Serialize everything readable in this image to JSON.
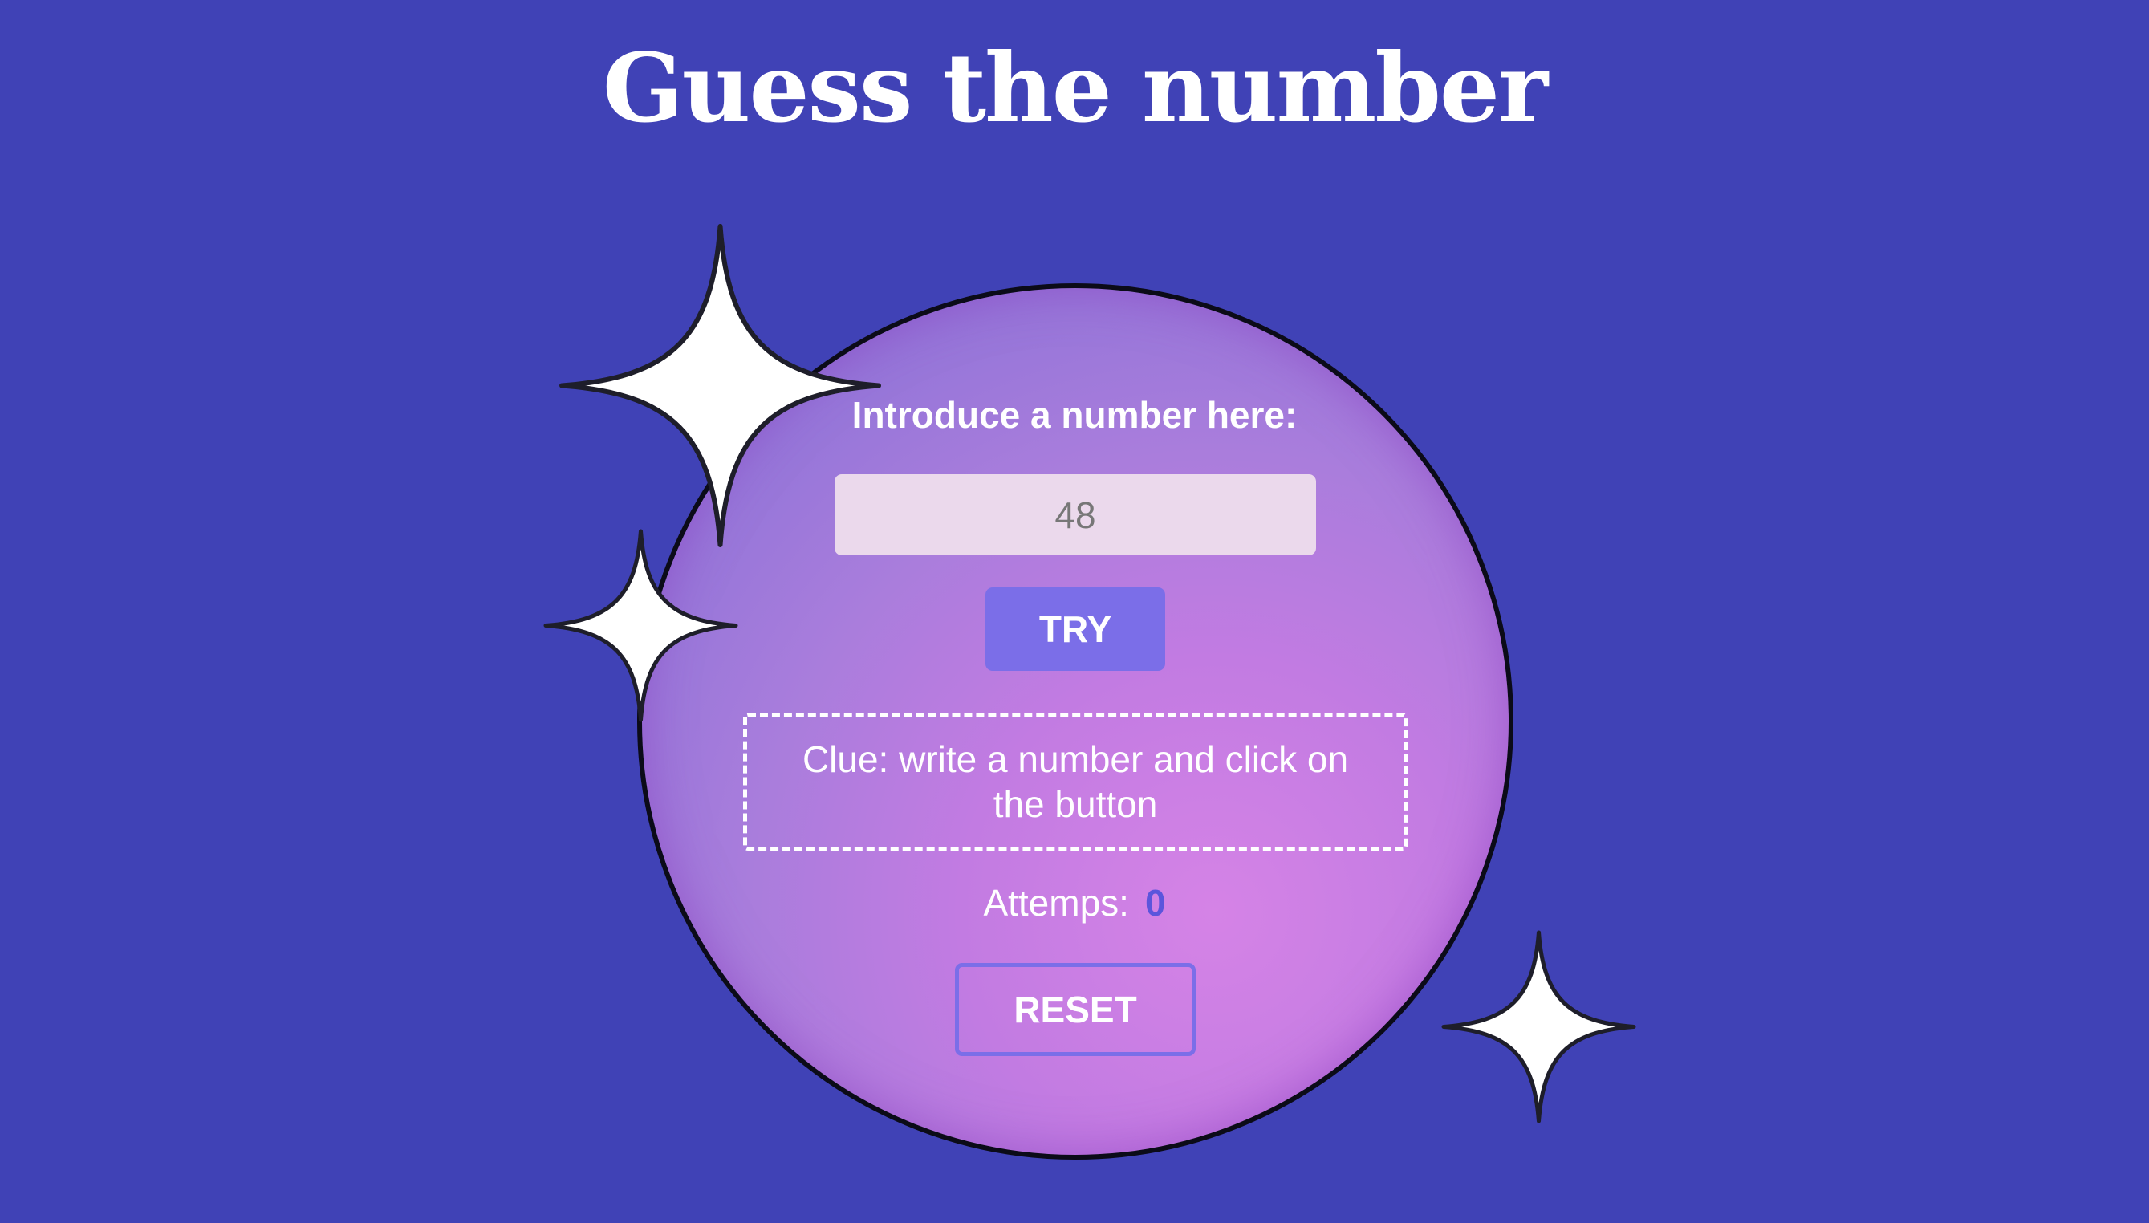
{
  "header": {
    "title": "Guess the number"
  },
  "game": {
    "input_label": "Introduce a number here:",
    "input_value": "48",
    "try_label": "TRY",
    "clue": "Clue: write a number and click on the button",
    "attempts_label": "Attemps:",
    "attempts_count": "0",
    "reset_label": "RESET"
  },
  "decorations": {
    "sparkle_icon": "four-point-star",
    "count": 3
  },
  "colors": {
    "background": "#4042b6",
    "orb_gradient_start": "#9174d8",
    "orb_gradient_end": "#d583e6",
    "button_accent": "#7b6ee8",
    "input_background": "#ebd9ec",
    "attempts_count": "#5b55dc"
  }
}
